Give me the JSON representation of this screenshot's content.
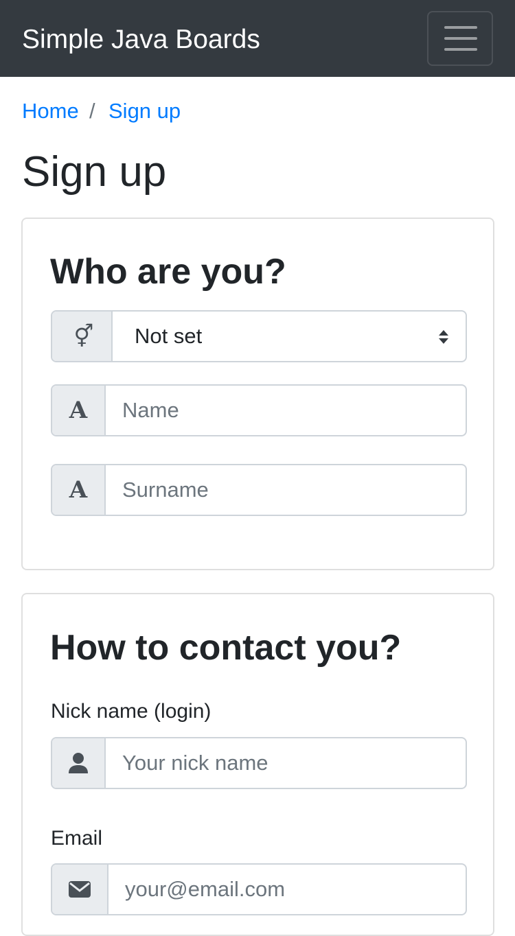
{
  "navbar": {
    "brand": "Simple Java Boards",
    "toggle_icon": "hamburger-menu-icon"
  },
  "breadcrumb": {
    "items": [
      "Home",
      "Sign up"
    ],
    "separator": "/"
  },
  "page_title": "Sign up",
  "who_card": {
    "title": "Who are you?",
    "gender_select": {
      "icon": "gender-icon",
      "icon_glyph": "⚥",
      "value": "Not set"
    },
    "name_field": {
      "icon": "letter-a-icon",
      "icon_glyph": "A",
      "placeholder": "Name"
    },
    "surname_field": {
      "icon": "letter-a-icon",
      "icon_glyph": "A",
      "placeholder": "Surname"
    }
  },
  "contact_card": {
    "title": "How to contact you?",
    "nick_label": "Nick name (login)",
    "nick_field": {
      "icon": "user-icon",
      "placeholder": "Your nick name"
    },
    "email_label": "Email",
    "email_field": {
      "icon": "envelope-icon",
      "placeholder": "your@email.com"
    }
  },
  "colors": {
    "navbar_bg": "#343a40",
    "link": "#007bff",
    "addon_bg": "#e9ecef",
    "border": "#ced4da",
    "placeholder": "#6c757d"
  }
}
